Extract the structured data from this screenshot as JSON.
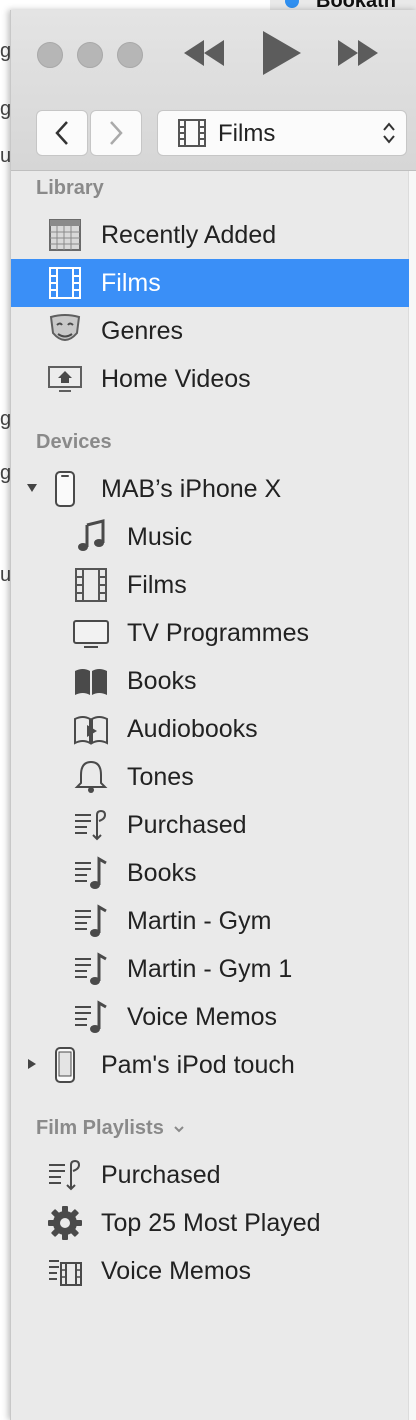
{
  "background": {
    "title": "Bookath"
  },
  "toolbar": {
    "selector_label": "Films"
  },
  "sidebar": {
    "library": {
      "title": "Library",
      "items": [
        {
          "label": "Recently Added",
          "icon": "calendar-grid-icon"
        },
        {
          "label": "Films",
          "icon": "film-icon",
          "selected": true
        },
        {
          "label": "Genres",
          "icon": "theatre-masks-icon"
        },
        {
          "label": "Home Videos",
          "icon": "home-video-icon"
        }
      ]
    },
    "devices": {
      "title": "Devices",
      "iphone": {
        "label": "MAB’s iPhone X",
        "expanded": true,
        "items": [
          {
            "label": "Music",
            "icon": "music-note-icon"
          },
          {
            "label": "Films",
            "icon": "film-icon"
          },
          {
            "label": "TV Programmes",
            "icon": "tv-icon"
          },
          {
            "label": "Books",
            "icon": "book-icon"
          },
          {
            "label": "Audiobooks",
            "icon": "audiobook-icon"
          },
          {
            "label": "Tones",
            "icon": "bell-icon"
          },
          {
            "label": "Purchased",
            "icon": "purchased-playlist-icon"
          },
          {
            "label": "Books",
            "icon": "playlist-icon"
          },
          {
            "label": "Martin - Gym",
            "icon": "playlist-icon"
          },
          {
            "label": "Martin - Gym 1",
            "icon": "playlist-icon"
          },
          {
            "label": "Voice Memos",
            "icon": "playlist-icon"
          }
        ]
      },
      "ipod": {
        "label": "Pam's iPod touch",
        "expanded": false
      }
    },
    "playlists": {
      "title": "Film Playlists",
      "items": [
        {
          "label": "Purchased",
          "icon": "purchased-playlist-icon"
        },
        {
          "label": "Top 25 Most Played",
          "icon": "gear-icon"
        },
        {
          "label": "Voice Memos",
          "icon": "video-playlist-icon"
        }
      ]
    }
  }
}
